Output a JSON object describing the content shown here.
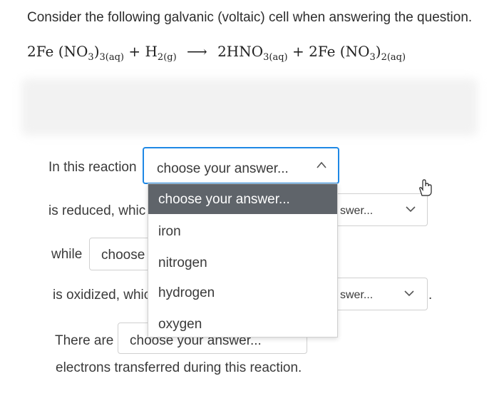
{
  "question": {
    "intro": "Consider the following galvanic (voltaic) cell when answering the question.",
    "equation": {
      "left1": "2Fe (NO",
      "left1_sub1": "3",
      "left1_close": ")",
      "left1_sub2": "3(aq)",
      "plus1": "+ H",
      "h2_sub": "2(g)",
      "arrow": "⟶",
      "right1": "2HNO",
      "right1_sub": "3(aq)",
      "plus2": "+ 2Fe (NO",
      "right2_sub1": "3",
      "right2_close": ")",
      "right2_sub2": "2(aq)"
    }
  },
  "form": {
    "row1_label": "In this reaction",
    "row1_select_value": "choose your answer...",
    "row2_label": "is reduced, whic",
    "row2_select_value": "swer...",
    "row3_label": "while",
    "row3_select_value": "choose",
    "row4_label": "is oxidized, whic",
    "row4_select_value": "swer...",
    "row5_label": "There are",
    "row5_select_value": "choose your answer...",
    "row5_suffix": "electrons transferred during this reaction.",
    "trailing_period": "."
  },
  "dropdown": {
    "options": [
      "choose your answer...",
      "iron",
      "nitrogen",
      "hydrogen",
      "oxygen"
    ],
    "selected_index": 0
  },
  "icons": {
    "open_chevron": "chevron-up-icon",
    "closed_chevron": "chevron-down-icon",
    "cursor": "hand-pointer-icon"
  },
  "colors": {
    "focus_border": "#1e88e5",
    "selected_option_bg": "#5f646a"
  }
}
